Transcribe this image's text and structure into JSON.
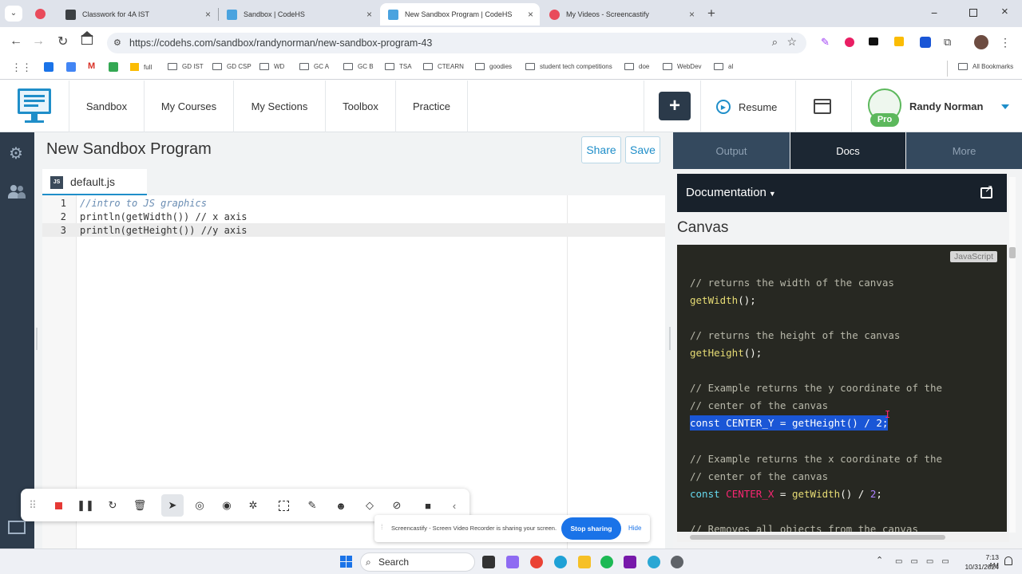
{
  "browser": {
    "tabs": [
      {
        "title": "Classwork for 4A IST",
        "favicon_color": "#3c4043"
      },
      {
        "title": "Sandbox | CodeHS",
        "favicon_color": "#4aa3df"
      },
      {
        "title": "New Sandbox Program | CodeHS",
        "favicon_color": "#4aa3df"
      },
      {
        "title": "My Videos - Screencastify",
        "favicon_color": "#e94b5b"
      }
    ],
    "url": "https://codehs.com/sandbox/randynorman/new-sandbox-program-43",
    "bookmarks": [
      "full",
      "GD IST",
      "GD CSP",
      "WD",
      "GC A",
      "GC B",
      "TSA",
      "CTEARN",
      "goodies",
      "student tech competitions",
      "doe",
      "WebDev",
      "al"
    ],
    "all_bookmarks": "All Bookmarks"
  },
  "codehs": {
    "nav": [
      "Sandbox",
      "My Courses",
      "My Sections",
      "Toolbox",
      "Practice"
    ],
    "resume": "Resume",
    "user_name": "Randy Norman",
    "pro_badge": "Pro",
    "program_title": "New Sandbox Program",
    "share_label": "Share",
    "save_label": "Save",
    "file_tab": "default.js",
    "file_badge": "JS",
    "code_lines": [
      "//intro to JS graphics",
      "println(getWidth()) // x axis",
      "println(getHeight()) //y axis"
    ],
    "line_numbers": [
      "1",
      "2",
      "3"
    ],
    "right_tabs": [
      "Output",
      "Docs",
      "More"
    ],
    "doc_menu": "Documentation",
    "doc_heading": "Canvas",
    "lang_badge": "JavaScript",
    "doc_code": {
      "c1": "// returns the width of the canvas",
      "l1": "getWidth",
      "l1b": "();",
      "c2": "// returns the height of the canvas",
      "l2": "getHeight",
      "l2b": "();",
      "c3": "// Example returns the y coordinate of the",
      "c4": "// center of the canvas",
      "cy_kw": "const",
      "cy_name": "CENTER_Y",
      "cy_rest": "= getHeight() / 2;",
      "c5": "// Example returns the x coordinate of the",
      "c6": "// center of the canvas",
      "cx_kw": "const",
      "cx_name": "CENTER_X",
      "cx_eq": "=",
      "cx_fn": "getWidth",
      "cx_mid": "() /",
      "cx_num": "2",
      "cx_end": ";",
      "c7": "// Removes all objects from the canvas"
    }
  },
  "screencastify": {
    "message": "Screencastify - Screen Video Recorder is sharing your screen.",
    "stop_label": "Stop sharing",
    "hide_label": "Hide"
  },
  "taskbar": {
    "search": "Search",
    "time": "7:13 AM",
    "date": "10/31/2024"
  },
  "colors": {
    "codehs_dark": "#2e3c4c",
    "accent_blue": "#1a73e8",
    "pro_green": "#5cb85c",
    "doc_code_bg": "#272822",
    "selection": "#1a56d6"
  }
}
